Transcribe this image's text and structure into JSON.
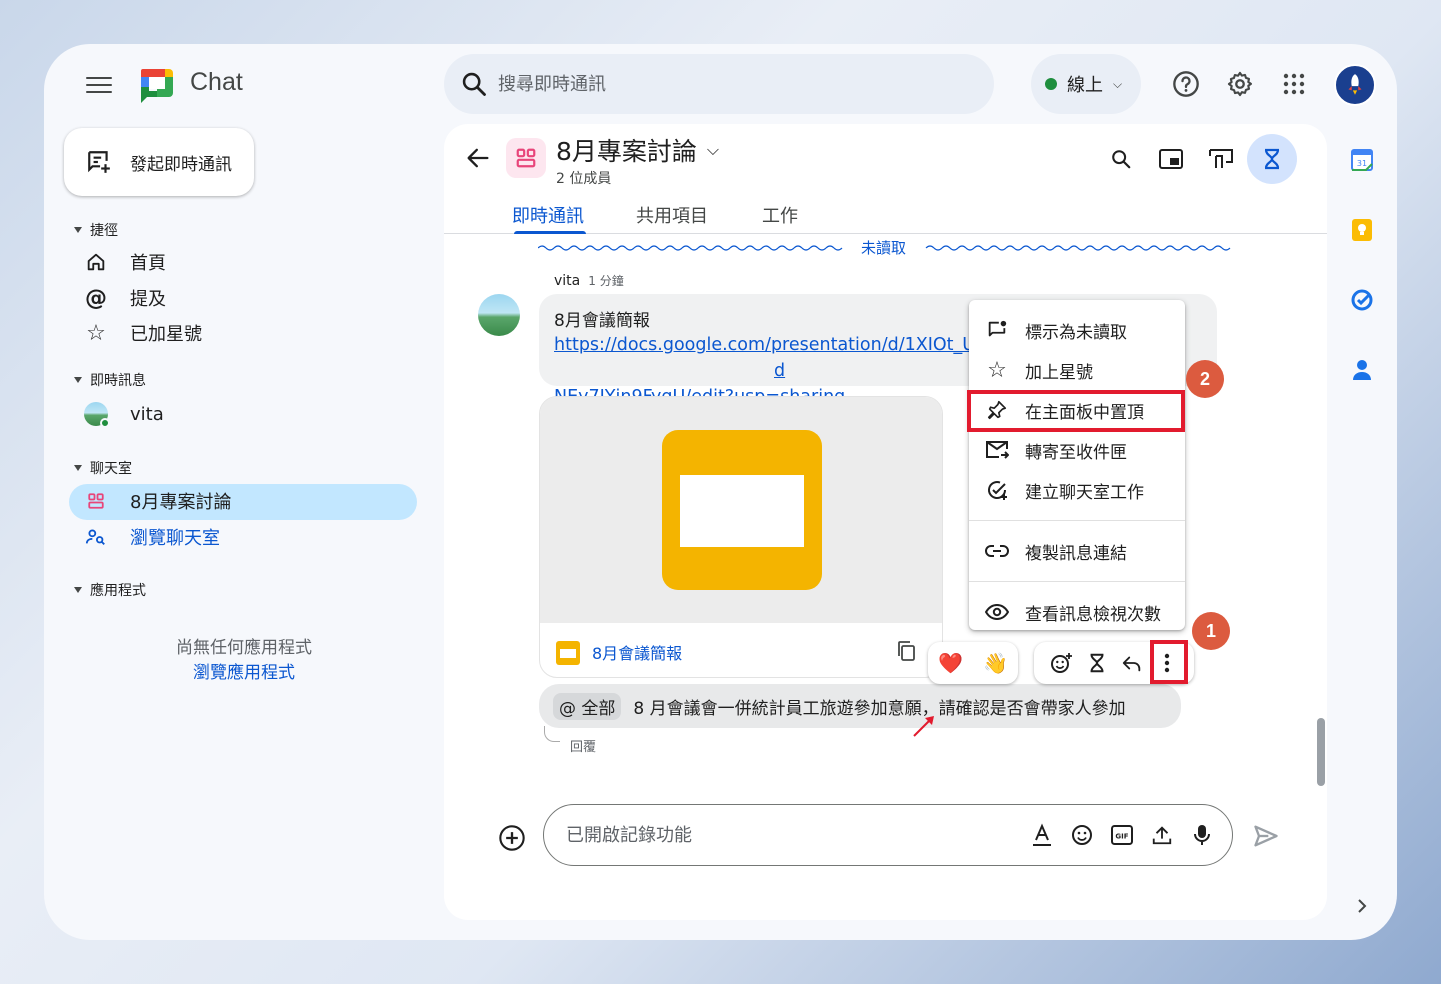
{
  "app": {
    "name": "Chat"
  },
  "search": {
    "placeholder": "搜尋即時通訊"
  },
  "status": {
    "label": "線上"
  },
  "sidebar": {
    "compose_label": "發起即時通訊",
    "shortcuts": {
      "title": "捷徑",
      "items": [
        "首頁",
        "提及",
        "已加星號"
      ]
    },
    "dm": {
      "title": "即時訊息",
      "items": [
        "vita"
      ]
    },
    "rooms": {
      "title": "聊天室",
      "items": [
        "8月專案討論",
        "瀏覽聊天室"
      ]
    },
    "apps": {
      "title": "應用程式",
      "empty": "尚無任何應用程式",
      "browse": "瀏覽應用程式"
    }
  },
  "room": {
    "title": "8月專案討論",
    "members": "2 位成員",
    "tabs": [
      "即時通訊",
      "共用項目",
      "工作"
    ]
  },
  "messages": {
    "unread_label": "未讀取",
    "sender": "vita",
    "time": "1 分鐘",
    "title": "8月會議簡報",
    "link": "https://docs.google.com/presentation/d/1XIOt_Ug",
    "link_tail": "d",
    "link_line2": "NEy7IYjn9FygU/edit?usp=sharing",
    "card_title": "8月會議簡報",
    "reply_mention": "@ 全部",
    "reply_text": "8 月會議會一併統計員工旅遊參加意願，請確認是否會帶家人參加",
    "reply_action": "回覆"
  },
  "reactions": [
    "❤️",
    "👋"
  ],
  "context_menu": {
    "items": [
      "標示為未讀取",
      "加上星號",
      "在主面板中置頂",
      "轉寄至收件匣",
      "建立聊天室工作",
      "複製訊息連結",
      "查看訊息檢視次數"
    ]
  },
  "annotations": {
    "badge1": "1",
    "badge2": "2"
  },
  "composer": {
    "placeholder": "已開啟記錄功能"
  },
  "colors": {
    "accent": "#0b57d0",
    "highlight": "#e21b2e",
    "badge": "#dc5b3f",
    "active_bg": "#c2e7ff"
  }
}
